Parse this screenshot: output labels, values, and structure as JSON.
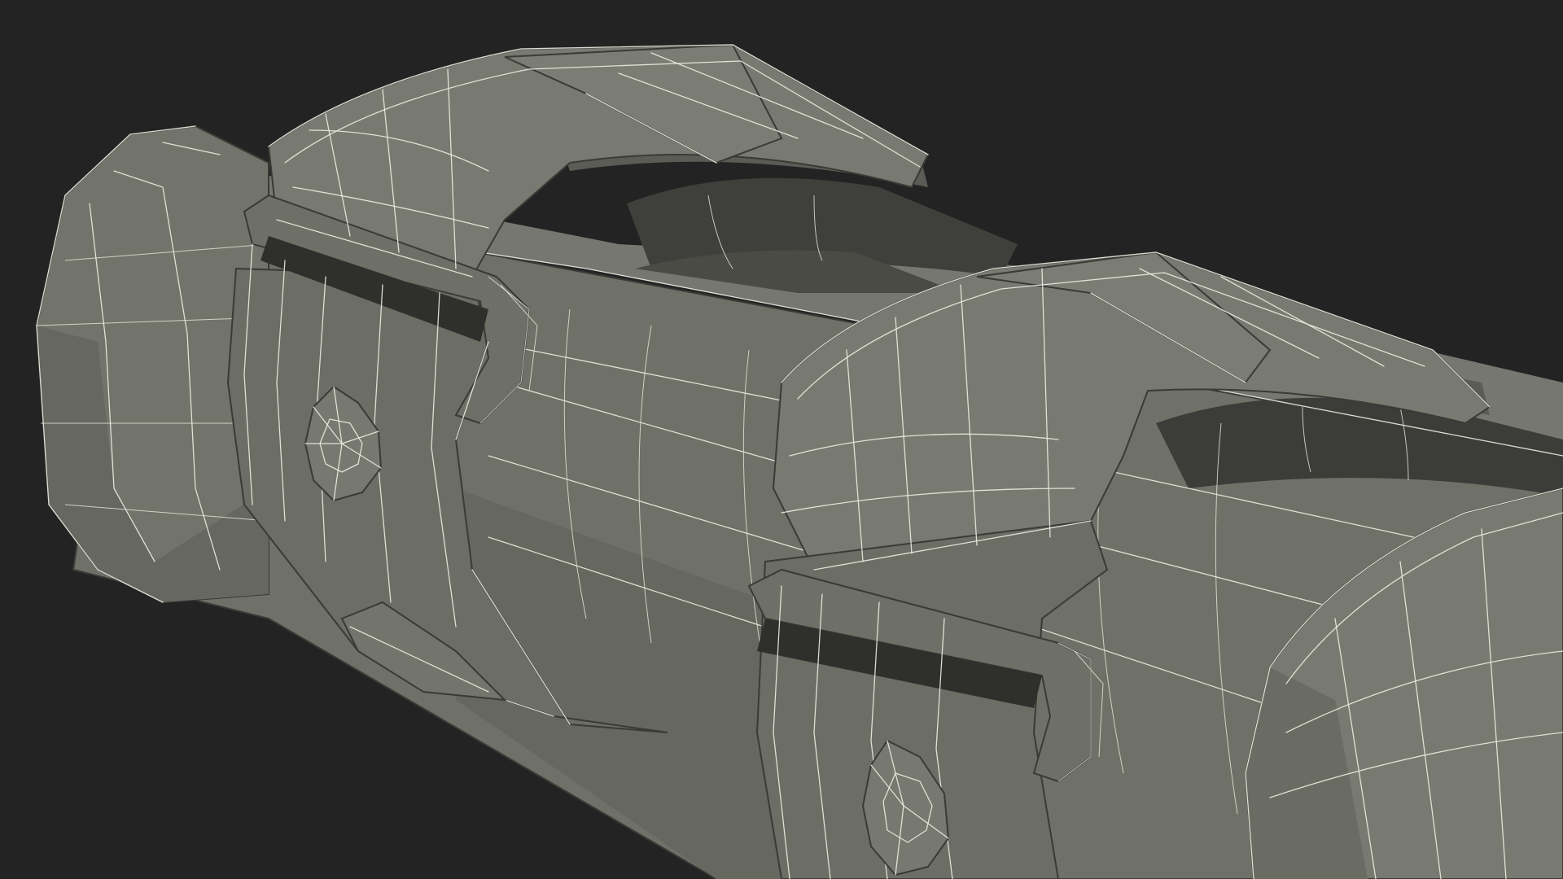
{
  "viewport": {
    "background": "#232323",
    "render_mode": "wireframe-on-shaded",
    "surface_color": "#75766c",
    "shadow_color": "#55564f",
    "interior_color": "#3d3e39",
    "wire_color": "#e9e9df"
  },
  "model": {
    "parts": [
      "tube-body",
      "end-cap",
      "strap-band",
      "strap-band",
      "strap-band",
      "buckle-loop",
      "buckle-loop",
      "rivet",
      "rivet"
    ]
  }
}
